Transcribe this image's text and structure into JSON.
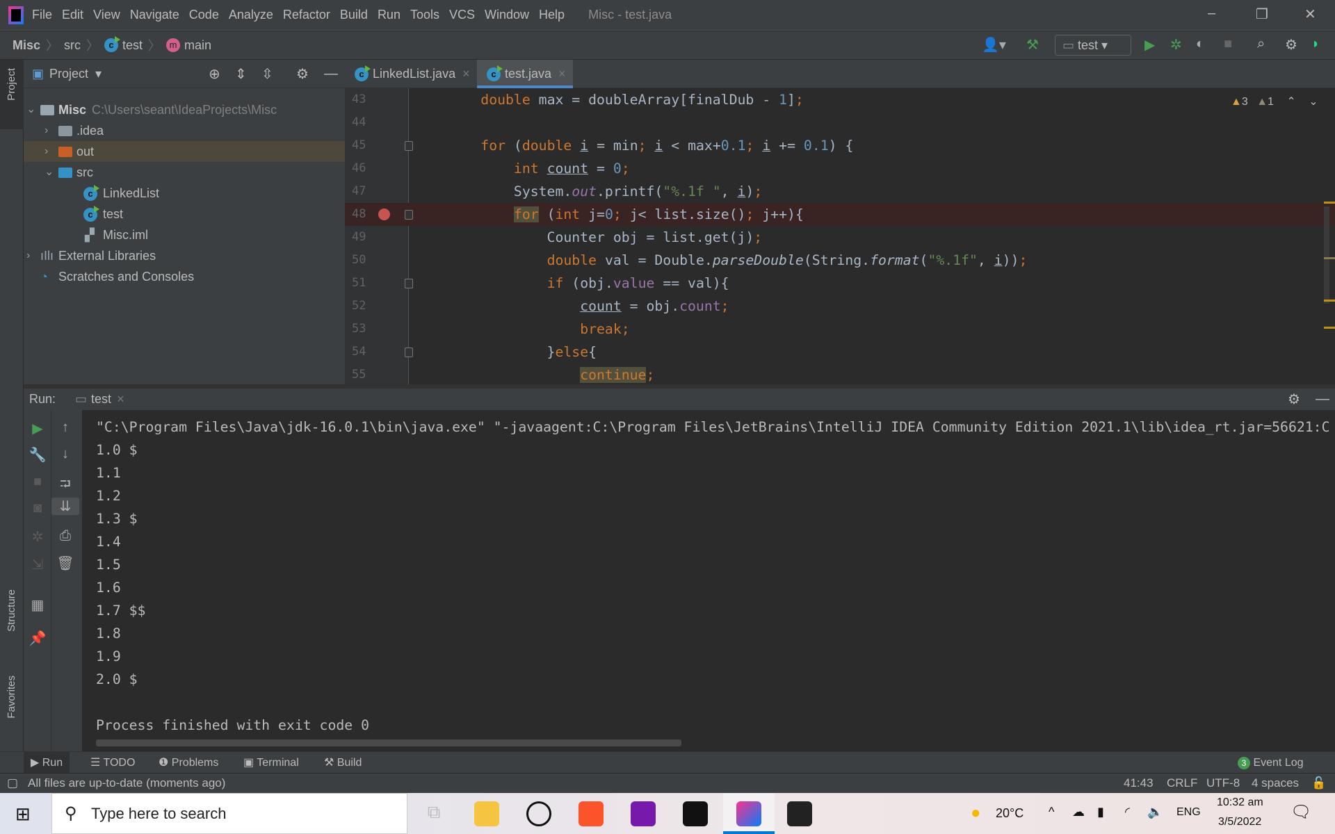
{
  "window": {
    "title": "Misc - test.java",
    "menu": [
      "File",
      "Edit",
      "View",
      "Navigate",
      "Code",
      "Analyze",
      "Refactor",
      "Build",
      "Run",
      "Tools",
      "VCS",
      "Window",
      "Help"
    ]
  },
  "breadcrumb": [
    "Misc",
    "src",
    "test",
    "main"
  ],
  "toolbar": {
    "run_config": "test"
  },
  "left_strip": {
    "project": "Project",
    "structure": "Structure",
    "favorites": "Favorites"
  },
  "project": {
    "title": "Project",
    "tree": [
      {
        "label": "Misc",
        "path": "C:\\Users\\seant\\IdeaProjects\\Misc",
        "expanded": true
      },
      {
        "label": ".idea"
      },
      {
        "label": "out",
        "selected": true
      },
      {
        "label": "src",
        "expanded": true
      },
      {
        "label": "LinkedList"
      },
      {
        "label": "test"
      },
      {
        "label": "Misc.iml"
      },
      {
        "label": "External Libraries"
      },
      {
        "label": "Scratches and Consoles"
      }
    ]
  },
  "editor": {
    "tabs": [
      {
        "label": "LinkedList.java"
      },
      {
        "label": "test.java",
        "active": true
      }
    ],
    "warnings": "3",
    "weak_warnings": "1",
    "lines": [
      {
        "n": "43",
        "t": [
          [
            "        ",
            ""
          ],
          [
            "double",
            "kw"
          ],
          [
            " max = doubleArray[finalDub - ",
            ""
          ],
          [
            "1",
            "num"
          ],
          [
            "]",
            ""
          ],
          [
            ";",
            "kw"
          ]
        ]
      },
      {
        "n": "44",
        "t": []
      },
      {
        "n": "45",
        "t": [
          [
            "        ",
            ""
          ],
          [
            "for",
            "kw"
          ],
          [
            " (",
            ""
          ],
          [
            "double",
            "kw"
          ],
          [
            " ",
            ""
          ],
          [
            "i",
            "ul"
          ],
          [
            " = min",
            ""
          ],
          [
            ";",
            "kw"
          ],
          [
            " ",
            ""
          ],
          [
            "i",
            "ul"
          ],
          [
            " < max+",
            ""
          ],
          [
            "0.1",
            "num"
          ],
          [
            ";",
            "kw"
          ],
          [
            " ",
            ""
          ],
          [
            "i",
            "ul"
          ],
          [
            " += ",
            ""
          ],
          [
            "0.1",
            "num"
          ],
          [
            ") {",
            ""
          ]
        ]
      },
      {
        "n": "46",
        "t": [
          [
            "            ",
            ""
          ],
          [
            "int",
            "kw"
          ],
          [
            " ",
            ""
          ],
          [
            "count",
            "ul"
          ],
          [
            " = ",
            ""
          ],
          [
            "0",
            "num"
          ],
          [
            ";",
            "kw"
          ]
        ]
      },
      {
        "n": "47",
        "t": [
          [
            "            System.",
            ""
          ],
          [
            "out",
            "fld it"
          ],
          [
            ".printf(",
            ""
          ],
          [
            "\"%.1f \"",
            "str"
          ],
          [
            ", ",
            ""
          ],
          [
            "i",
            "ul"
          ],
          [
            ")",
            ""
          ],
          [
            ";",
            "kw"
          ]
        ]
      },
      {
        "n": "48",
        "bp": true,
        "t": [
          [
            "            ",
            ""
          ],
          [
            "for",
            "kw hl"
          ],
          [
            " (",
            ""
          ],
          [
            "int",
            "kw"
          ],
          [
            " j=",
            ""
          ],
          [
            "0",
            "num"
          ],
          [
            ";",
            "kw"
          ],
          [
            " j< list.size()",
            ""
          ],
          [
            ";",
            "kw"
          ],
          [
            " j++){",
            ""
          ]
        ]
      },
      {
        "n": "49",
        "t": [
          [
            "                Counter obj = list.get(j)",
            ""
          ],
          [
            ";",
            "kw"
          ]
        ]
      },
      {
        "n": "50",
        "t": [
          [
            "                ",
            ""
          ],
          [
            "double",
            "kw"
          ],
          [
            " val = Double.",
            ""
          ],
          [
            "parseDouble",
            "it"
          ],
          [
            "(String.",
            ""
          ],
          [
            "format",
            "it"
          ],
          [
            "(",
            ""
          ],
          [
            "\"%.1f\"",
            "str"
          ],
          [
            ", ",
            ""
          ],
          [
            "i",
            "ul"
          ],
          [
            "))",
            ""
          ],
          [
            ";",
            "kw"
          ]
        ]
      },
      {
        "n": "51",
        "t": [
          [
            "                ",
            ""
          ],
          [
            "if",
            "kw"
          ],
          [
            " (obj.",
            ""
          ],
          [
            "value",
            "fld"
          ],
          [
            " == val){",
            ""
          ]
        ]
      },
      {
        "n": "52",
        "t": [
          [
            "                    ",
            ""
          ],
          [
            "count",
            "ul"
          ],
          [
            " = obj.",
            ""
          ],
          [
            "count",
            "fld"
          ],
          [
            ";",
            "kw"
          ]
        ]
      },
      {
        "n": "53",
        "t": [
          [
            "                    ",
            ""
          ],
          [
            "break",
            "kw"
          ],
          [
            ";",
            "kw"
          ]
        ]
      },
      {
        "n": "54",
        "t": [
          [
            "                }",
            ""
          ],
          [
            "else",
            "kw"
          ],
          [
            "{",
            ""
          ]
        ]
      },
      {
        "n": "55",
        "t": [
          [
            "                    ",
            ""
          ],
          [
            "continue",
            "kw hl"
          ],
          [
            ";",
            "kw"
          ]
        ]
      }
    ]
  },
  "run": {
    "label": "Run:",
    "tab": "test",
    "output": [
      "\"C:\\Program Files\\Java\\jdk-16.0.1\\bin\\java.exe\" \"-javaagent:C:\\Program Files\\JetBrains\\IntelliJ IDEA Community Edition 2021.1\\lib\\idea_rt.jar=56621:C",
      "1.0 $",
      "1.1",
      "1.2",
      "1.3 $",
      "1.4",
      "1.5",
      "1.6",
      "1.7 $$",
      "1.8",
      "1.9",
      "2.0 $",
      "",
      "Process finished with exit code 0"
    ]
  },
  "tool_tabs": [
    "Run",
    "TODO",
    "Problems",
    "Terminal",
    "Build"
  ],
  "event_log": {
    "label": "Event Log",
    "count": "3"
  },
  "status": {
    "message": "All files are up-to-date (moments ago)",
    "position": "41:43",
    "line_sep": "CRLF",
    "encoding": "UTF-8",
    "indent": "4 spaces"
  },
  "taskbar": {
    "search_placeholder": "Type here to search",
    "temp": "20°C",
    "lang": "ENG",
    "time": "10:32 am",
    "date": "3/5/2022"
  }
}
